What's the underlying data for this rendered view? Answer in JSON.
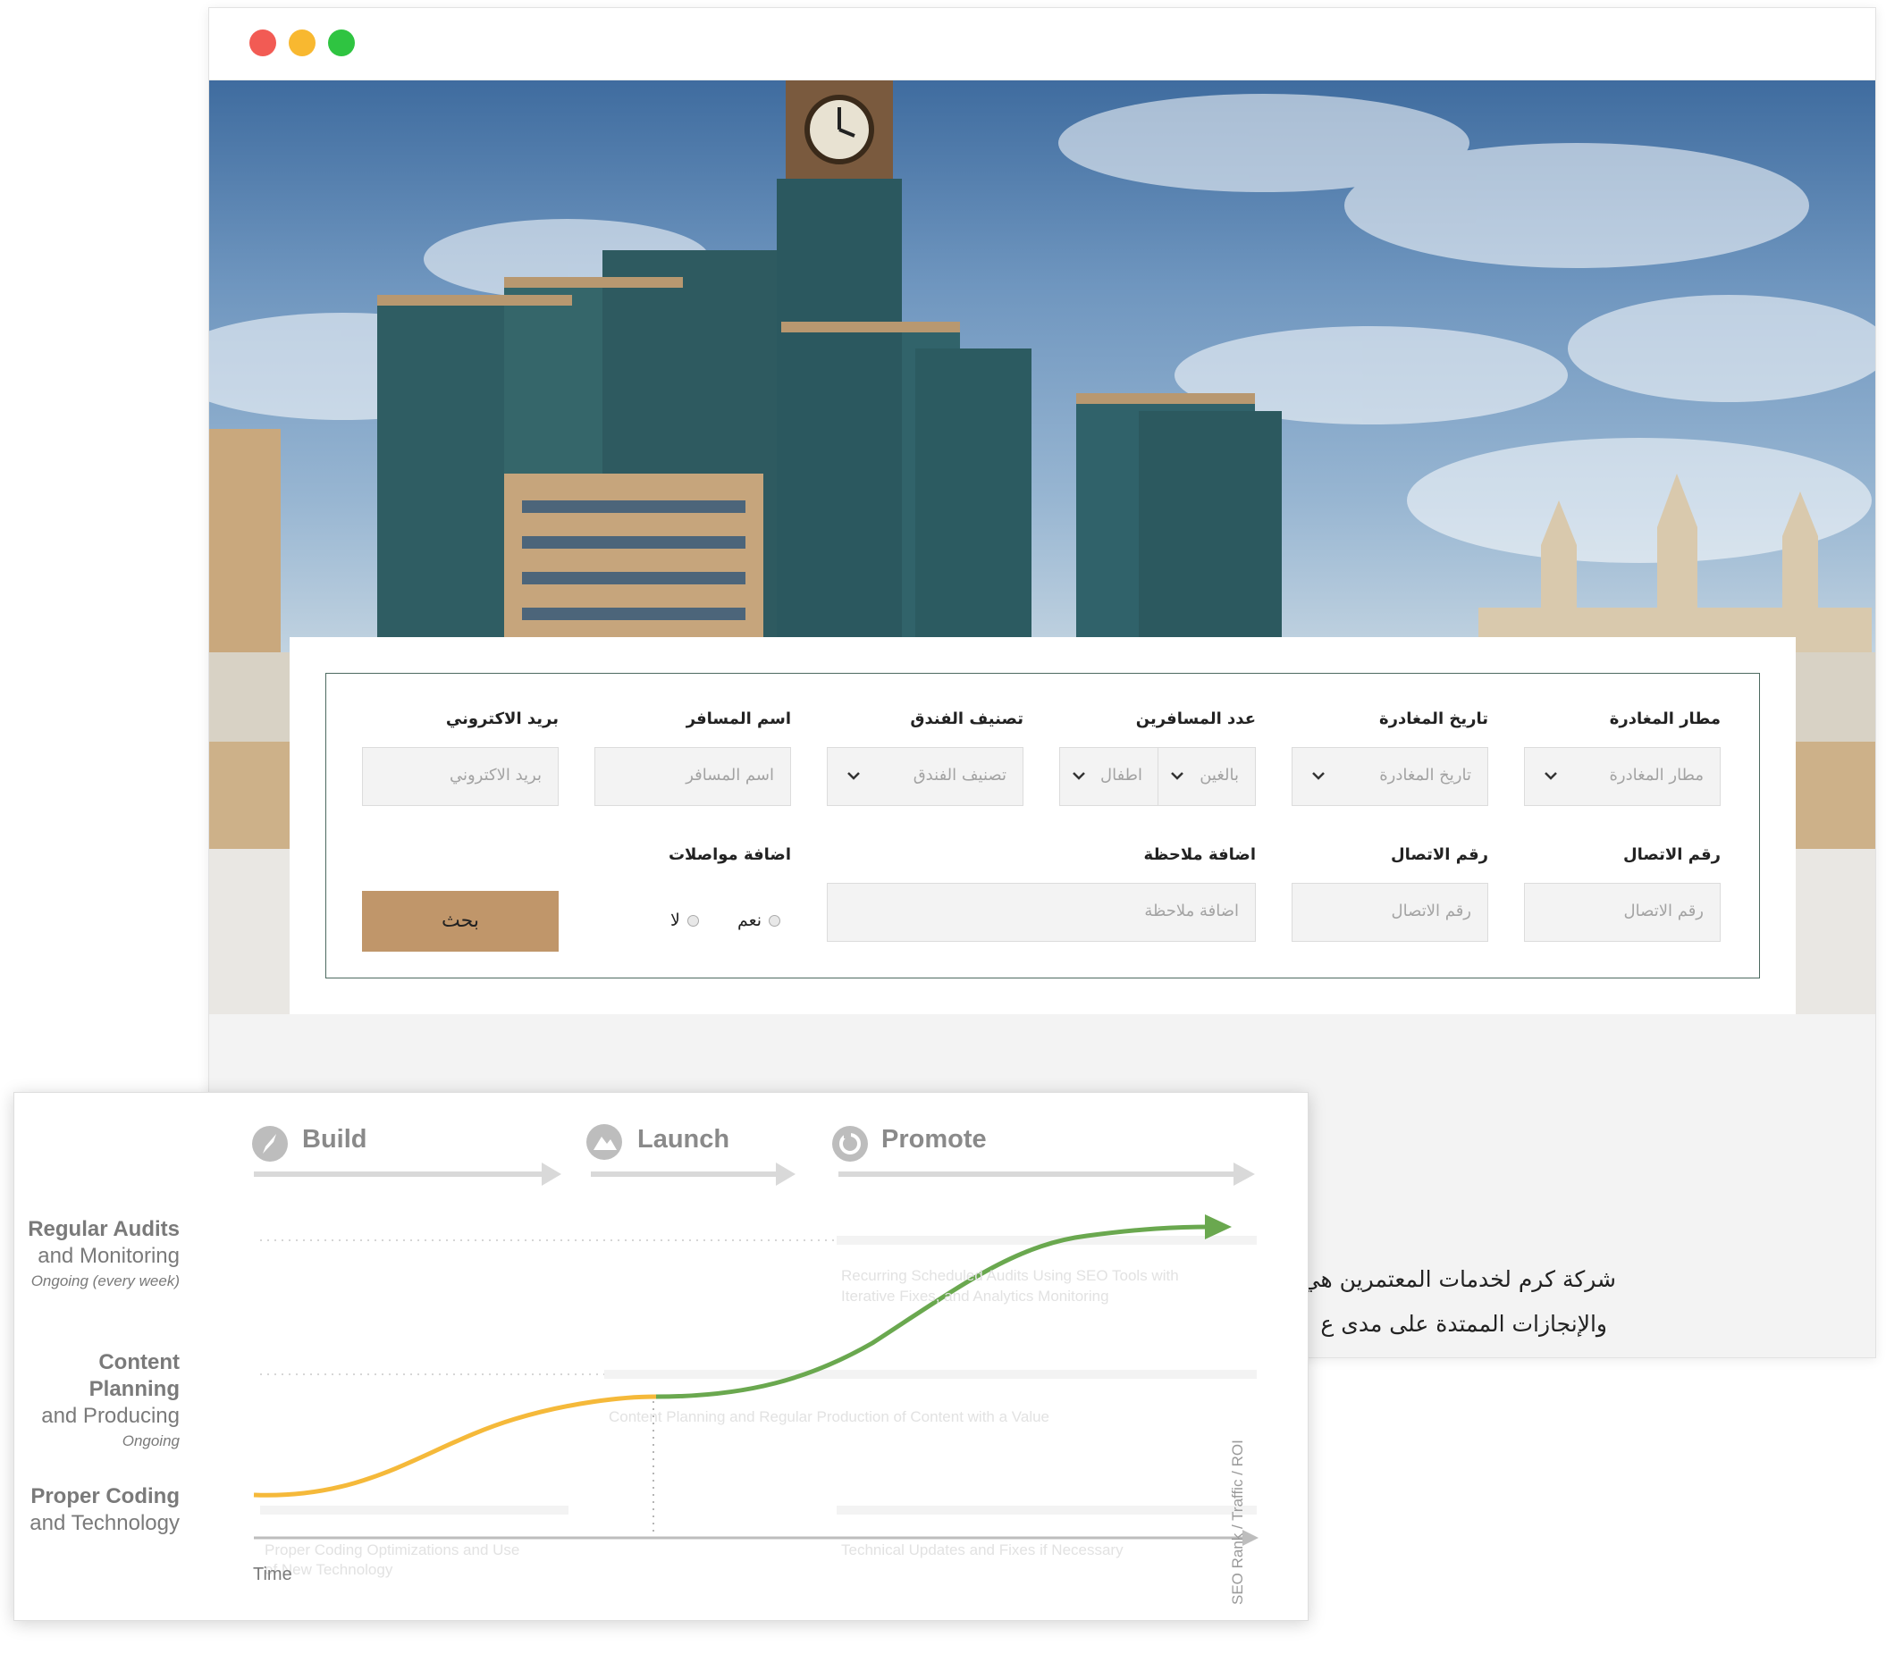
{
  "form": {
    "row1": [
      {
        "label": "مطار المغادرة",
        "placeholder": "مطار المغادرة"
      },
      {
        "label": "تاريخ المغادرة",
        "placeholder": "تاريخ المغادرة"
      },
      {
        "label": "عدد المسافرين",
        "adults": "بالغين",
        "children": "اطفال"
      },
      {
        "label": "تصنيف الفندق",
        "placeholder": "تصنيف الفندق"
      },
      {
        "label": "اسم المسافر",
        "placeholder": "اسم المسافر"
      },
      {
        "label": "بريد الاكتروني",
        "placeholder": "بريد الاكتروني"
      }
    ],
    "row2": [
      {
        "label": "رقم الاتصال",
        "placeholder": "رقم الاتصال"
      },
      {
        "label": "رقم الاتصال",
        "placeholder": "رقم الاتصال"
      },
      {
        "label": "اضافة ملاحظة",
        "placeholder": "اضافة ملاحظة"
      }
    ],
    "transport": {
      "label": "اضافة مواصلات",
      "yes": "نعم",
      "no": "لا"
    },
    "search_button": "بحث"
  },
  "about": {
    "line1": "شركة كرم لخدمات المعتمرين هي",
    "line2": "والإنجازات الممتدة على مدى ع"
  },
  "chart_data": {
    "type": "line",
    "phases": [
      "Build",
      "Launch",
      "Promote"
    ],
    "rows": [
      {
        "title": "Regular Audits",
        "title2": "and Monitoring",
        "subtitle": "Ongoing (every week)",
        "caption_a": "Recurring Scheduled Audits Using SEO Tools with",
        "caption_b": "Iterative Fixes, and Analytics Monitoring"
      },
      {
        "title": "Content Planning",
        "title2": "and Producing",
        "subtitle": "Ongoing",
        "caption_a": "Content Planning and Regular Production of Content with a Value"
      },
      {
        "title": "Proper Coding",
        "title2": "and Technology",
        "subtitle": "",
        "caption_a": "Proper Coding Optimizations and Use",
        "caption_b": "of New Technology",
        "caption_c": "Technical Updates and Fixes if Necessary"
      }
    ],
    "xlabel": "Time",
    "ylabel": "SEO Rank / Traffic / ROI",
    "colors": {
      "build": "#f5b93a",
      "promote": "#6aa84f",
      "phase_grey": "#8a8a8a",
      "arrow_grey": "#d9d9d9"
    }
  },
  "colors": {
    "accent": "#c0966a",
    "form_border": "#4d6a60"
  }
}
